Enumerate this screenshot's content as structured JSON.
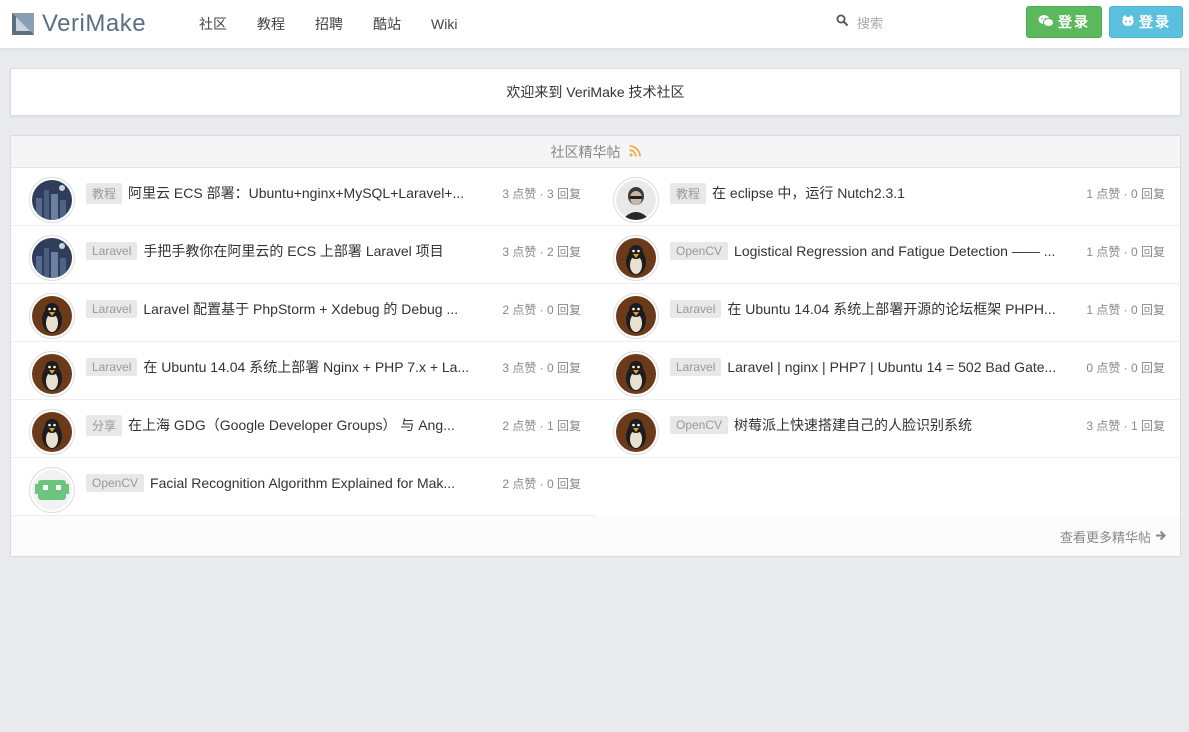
{
  "brand": {
    "name": "VeriMake"
  },
  "nav": {
    "items": [
      {
        "label": "社区"
      },
      {
        "label": "教程"
      },
      {
        "label": "招聘"
      },
      {
        "label": "酷站"
      },
      {
        "label": "Wiki"
      }
    ]
  },
  "search": {
    "placeholder": "搜索",
    "icon": "search-icon"
  },
  "auth": {
    "wechat_label": "登录",
    "wechat_icon": "wechat-icon",
    "github_label": "登录",
    "github_icon": "github-icon"
  },
  "welcome": {
    "text": "欢迎来到 VeriMake 技术社区"
  },
  "featured": {
    "title": "社区精华帖",
    "rss_icon": "rss-icon",
    "more_label": "查看更多精华帖",
    "topics_left": [
      {
        "tag": "教程",
        "title": "阿里云 ECS 部署：Ubuntu+nginx+MySQL+Laravel+...",
        "meta": "3 点赞 · 3 回复",
        "avatar": "city-avatar"
      },
      {
        "tag": "Laravel",
        "title": "手把手教你在阿里云的 ECS 上部署 Laravel 项目",
        "meta": "3 点赞 · 2 回复",
        "avatar": "city-avatar"
      },
      {
        "tag": "Laravel",
        "title": "Laravel 配置基于 PhpStorm + Xdebug 的 Debug ...",
        "meta": "2 点赞 · 0 回复",
        "avatar": "tux-avatar"
      },
      {
        "tag": "Laravel",
        "title": "在 Ubuntu 14.04 系统上部署 Nginx + PHP 7.x + La...",
        "meta": "3 点赞 · 0 回复",
        "avatar": "tux-avatar"
      },
      {
        "tag": "分享",
        "title": "在上海 GDG（Google Developer Groups） 与 Ang...",
        "meta": "2 点赞 · 1 回复",
        "avatar": "tux-avatar"
      },
      {
        "tag": "OpenCV",
        "title": "Facial Recognition Algorithm Explained for Mak...",
        "meta": "2 点赞 · 0 回复",
        "avatar": "robot-avatar"
      }
    ],
    "topics_right": [
      {
        "tag": "教程",
        "title": "在 eclipse 中，运行 Nutch2.3.1",
        "meta": "1 点赞 · 0 回复",
        "avatar": "person-avatar"
      },
      {
        "tag": "OpenCV",
        "title": "Logistical Regression and Fatigue Detection —— ...",
        "meta": "1 点赞 · 0 回复",
        "avatar": "tux-avatar"
      },
      {
        "tag": "Laravel",
        "title": "在 Ubuntu 14.04 系统上部署开源的论坛框架 PHPH...",
        "meta": "1 点赞 · 0 回复",
        "avatar": "tux-avatar"
      },
      {
        "tag": "Laravel",
        "title": "Laravel | nginx | PHP7 | Ubuntu 14 = 502 Bad Gate...",
        "meta": "0 点赞 · 0 回复",
        "avatar": "tux-avatar"
      },
      {
        "tag": "OpenCV",
        "title": "树莓派上快速搭建自己的人脸识别系统",
        "meta": "3 点赞 · 1 回复",
        "avatar": "tux-avatar"
      }
    ]
  },
  "colors": {
    "wechat_green": "#5cb85c",
    "github_blue": "#5bc0de",
    "rss_orange": "#f0ad4e",
    "background": "#e9eaed"
  }
}
